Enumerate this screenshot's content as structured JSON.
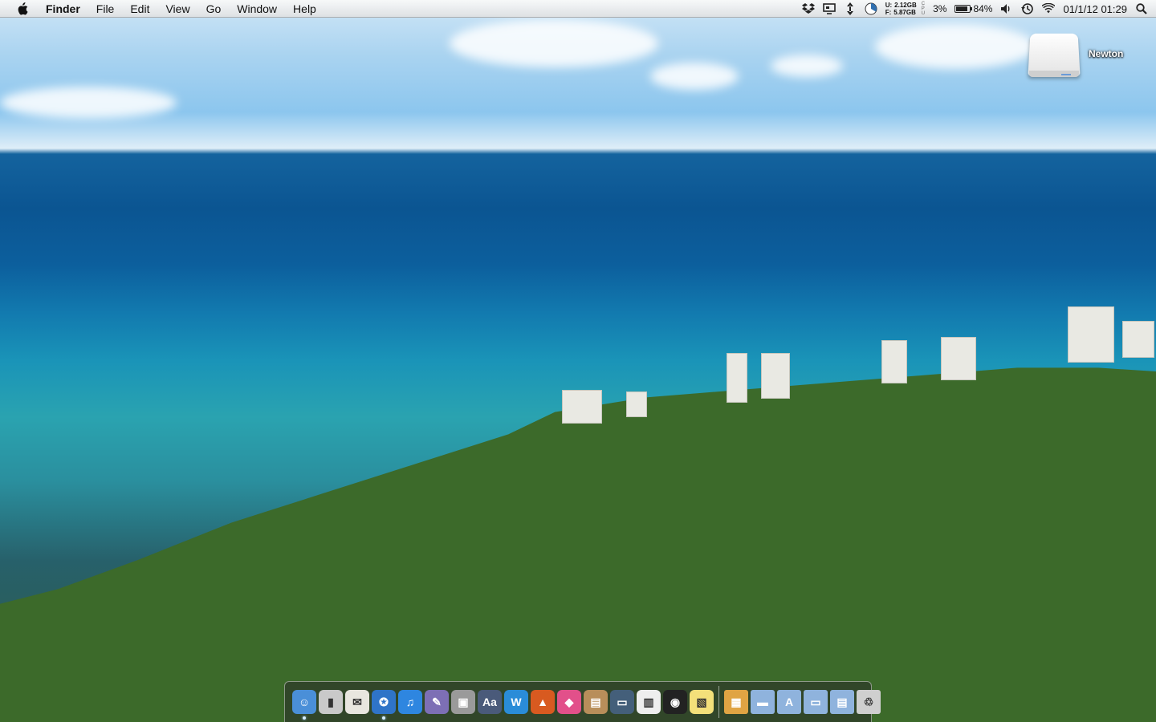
{
  "menubar": {
    "apple_icon": "apple-icon",
    "app_name": "Finder",
    "items": [
      "File",
      "Edit",
      "View",
      "Go",
      "Window",
      "Help"
    ]
  },
  "status": {
    "icons": [
      "dropbox-icon",
      "display-icon",
      "sync-arrows-icon",
      "disk-usage-pie-icon"
    ],
    "memory": {
      "u_label": "U:",
      "u_value": "2.12GB",
      "f_label": "F:",
      "f_value": "5.87GB"
    },
    "cpu_label": "CPU",
    "cpu_value": "3%",
    "battery": {
      "percent_text": "84%",
      "level": 0.84
    },
    "datetime": "01/1/12 01:29"
  },
  "desktop": {
    "drive_label": "Newton"
  },
  "dock": {
    "apps": [
      {
        "name": "finder",
        "icon": "finder-icon",
        "running": true,
        "color": "#4a8fd8"
      },
      {
        "name": "sidebar-app",
        "icon": "drive-stack-icon",
        "running": false,
        "color": "#c9c9c9"
      },
      {
        "name": "mail",
        "icon": "stamp-mail-icon",
        "running": false,
        "color": "#e8e6df"
      },
      {
        "name": "safari",
        "icon": "compass-icon",
        "running": true,
        "color": "#2f74c8"
      },
      {
        "name": "itunes",
        "icon": "music-note-icon",
        "running": false,
        "color": "#2e86e0"
      },
      {
        "name": "brush-app",
        "icon": "paint-brush-icon",
        "running": false,
        "color": "#7d6fb5"
      },
      {
        "name": "app-store",
        "icon": "apple-box-icon",
        "running": false,
        "color": "#9a9a9a"
      },
      {
        "name": "dictionary",
        "icon": "dictionary-icon",
        "running": false,
        "color": "#4a5a7a"
      },
      {
        "name": "word",
        "icon": "w-letter-icon",
        "running": false,
        "color": "#2a8cd8"
      },
      {
        "name": "matlab",
        "icon": "matlab-icon",
        "running": false,
        "color": "#d85a20"
      },
      {
        "name": "color-app",
        "icon": "color-cube-icon",
        "running": false,
        "color": "#e2508a"
      },
      {
        "name": "photos",
        "icon": "photo-stack-icon",
        "running": false,
        "color": "#b88e5a"
      },
      {
        "name": "screen-app",
        "icon": "person-monitor-icon",
        "running": false,
        "color": "#445f7a"
      },
      {
        "name": "music-keys",
        "icon": "piano-keys-icon",
        "running": false,
        "color": "#eeeeee"
      },
      {
        "name": "camera-app",
        "icon": "camera-lens-icon",
        "running": false,
        "color": "#222222"
      },
      {
        "name": "stickies",
        "icon": "sticky-note-icon",
        "running": false,
        "color": "#f3e07a"
      }
    ],
    "stacks": [
      {
        "name": "downloads-stack",
        "icon": "box-stack-icon",
        "color": "#e0a443"
      },
      {
        "name": "folder-stack-1",
        "icon": "folder-icon",
        "color": "#8fb3dd"
      },
      {
        "name": "applications-folder",
        "icon": "apps-folder-icon",
        "color": "#8fb3dd"
      },
      {
        "name": "documents-folder",
        "icon": "docs-folder-icon",
        "color": "#8fb3dd"
      },
      {
        "name": "file-folder",
        "icon": "file-folder-icon",
        "color": "#8fb3dd"
      },
      {
        "name": "trash",
        "icon": "trash-icon",
        "color": "#cfcfcf"
      }
    ]
  }
}
